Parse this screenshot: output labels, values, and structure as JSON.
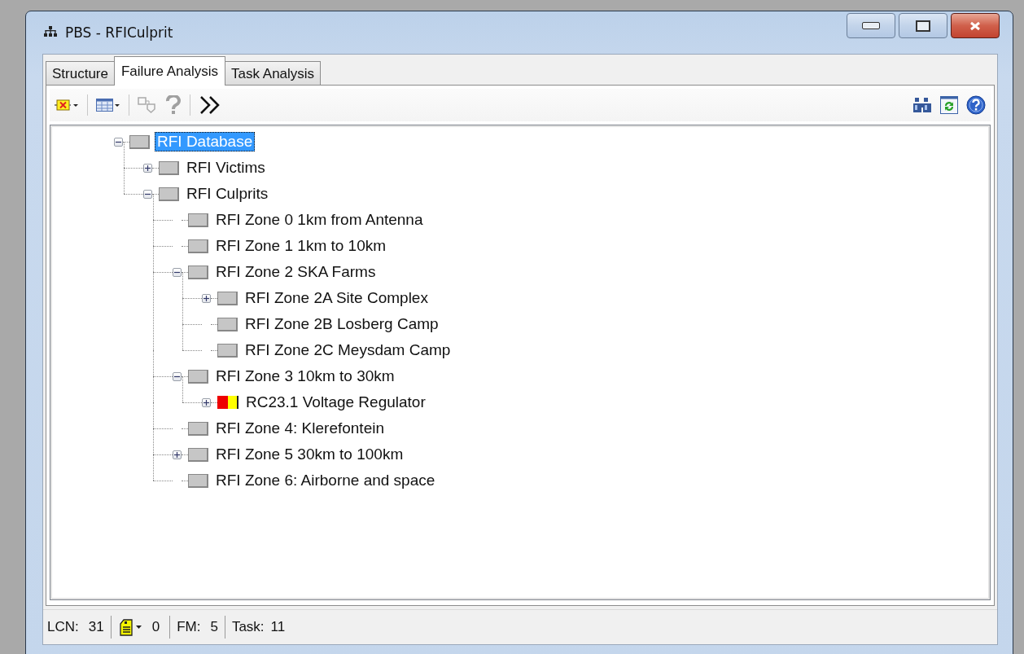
{
  "window": {
    "title": "PBS - RFICulprit"
  },
  "tabs": [
    {
      "label": "Structure",
      "selected": false
    },
    {
      "label": "Failure Analysis",
      "selected": true
    },
    {
      "label": "Task Analysis",
      "selected": false
    }
  ],
  "tree": [
    {
      "label": "RFI Database",
      "kind": "node",
      "selected": true,
      "expanded": true,
      "children": [
        {
          "label": "RFI Victims",
          "kind": "node",
          "selected": false,
          "expanded": false
        },
        {
          "label": "RFI Culprits",
          "kind": "node",
          "selected": false,
          "expanded": true,
          "children": [
            {
              "label": "RFI Zone 0 1km from Antenna",
              "kind": "node",
              "selected": false
            },
            {
              "label": "RFI Zone 1 1km to 10km",
              "kind": "node",
              "selected": false
            },
            {
              "label": "RFI Zone 2 SKA Farms",
              "kind": "node",
              "selected": false,
              "expanded": true,
              "children": [
                {
                  "label": "RFI Zone 2A Site Complex",
                  "kind": "node",
                  "selected": false,
                  "expanded": false
                },
                {
                  "label": "RFI Zone 2B Losberg Camp",
                  "kind": "node",
                  "selected": false
                },
                {
                  "label": "RFI Zone 2C Meysdam Camp",
                  "kind": "node",
                  "selected": false
                }
              ]
            },
            {
              "label": "RFI Zone 3 10km to 30km",
              "kind": "node",
              "selected": false,
              "expanded": true,
              "children": [
                {
                  "label": "RC23.1 Voltage Regulator",
                  "kind": "status",
                  "selected": false,
                  "expanded": false
                }
              ]
            },
            {
              "label": "RFI Zone 4: Klerefontein",
              "kind": "node",
              "selected": false
            },
            {
              "label": "RFI Zone 5 30km to 100km",
              "kind": "node",
              "selected": false,
              "expanded": false
            },
            {
              "label": "RFI Zone 6: Airborne and space",
              "kind": "node",
              "selected": false
            }
          ]
        }
      ]
    }
  ],
  "status_bar": {
    "lcn_label": "LCN:",
    "lcn": "31",
    "lock_count": "0",
    "fm_label": "FM:",
    "fm": "5",
    "task_label": "Task:",
    "task": "11"
  }
}
